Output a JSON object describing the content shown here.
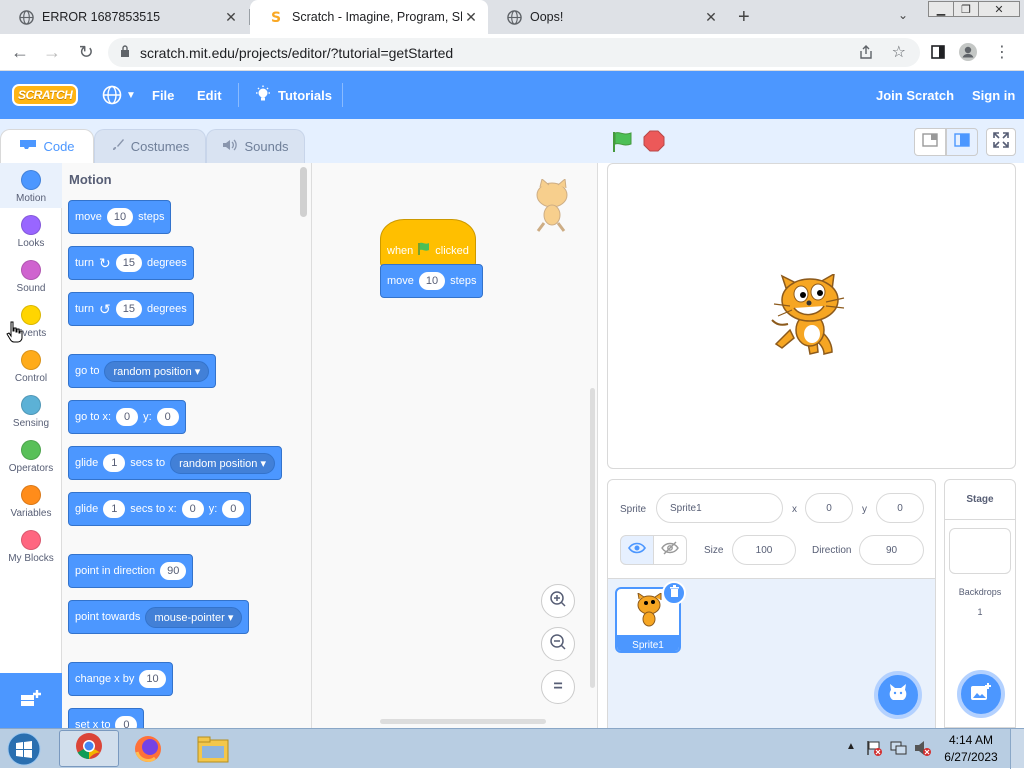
{
  "browser": {
    "tabs": [
      {
        "title": "ERROR 1687853515",
        "active": false
      },
      {
        "title": "Scratch - Imagine, Program, Shar",
        "active": true
      },
      {
        "title": "Oops!",
        "active": false
      }
    ],
    "new_tab": "+",
    "url": "scratch.mit.edu/projects/editor/?tutorial=getStarted"
  },
  "menubar": {
    "logo": "SCRATCH",
    "file": "File",
    "edit": "Edit",
    "tutorials": "Tutorials",
    "join": "Join Scratch",
    "signin": "Sign in"
  },
  "editor_tabs": {
    "code": "Code",
    "costumes": "Costumes",
    "sounds": "Sounds"
  },
  "categories": [
    {
      "label": "Motion",
      "color": "#4c97ff"
    },
    {
      "label": "Looks",
      "color": "#9966ff"
    },
    {
      "label": "Sound",
      "color": "#cf63cf"
    },
    {
      "label": "Events",
      "color": "#ffd500"
    },
    {
      "label": "Control",
      "color": "#ffab19"
    },
    {
      "label": "Sensing",
      "color": "#5cb1d6"
    },
    {
      "label": "Operators",
      "color": "#59c059"
    },
    {
      "label": "Variables",
      "color": "#ff8c1a"
    },
    {
      "label": "My Blocks",
      "color": "#ff6680"
    }
  ],
  "palette": {
    "heading": "Motion",
    "move": {
      "a": "move",
      "v": "10",
      "b": "steps"
    },
    "turn_cw": {
      "a": "turn",
      "v": "15",
      "b": "degrees"
    },
    "turn_ccw": {
      "a": "turn",
      "v": "15",
      "b": "degrees"
    },
    "goto": {
      "a": "go to",
      "dd": "random position"
    },
    "gotoxy": {
      "a": "go to x:",
      "x": "0",
      "b": "y:",
      "y": "0"
    },
    "glide1": {
      "a": "glide",
      "v": "1",
      "b": "secs to",
      "dd": "random position"
    },
    "glide2": {
      "a": "glide",
      "v": "1",
      "b": "secs to x:",
      "x": "0",
      "c": "y:",
      "y": "0"
    },
    "point_dir": {
      "a": "point in direction",
      "v": "90"
    },
    "point_towards": {
      "a": "point towards",
      "dd": "mouse-pointer"
    },
    "change_x": {
      "a": "change x by",
      "v": "10"
    },
    "set_x": {
      "a": "set x to",
      "v": "0"
    }
  },
  "script": {
    "hat": {
      "a": "when",
      "b": "clicked"
    },
    "move": {
      "a": "move",
      "v": "10",
      "b": "steps"
    },
    "zoom_in": "+",
    "zoom_out": "−",
    "zoom_reset": "="
  },
  "sprite_info": {
    "sprite_label": "Sprite",
    "sprite_name": "Sprite1",
    "x_label": "x",
    "x": "0",
    "y_label": "y",
    "y": "0",
    "show_label": "Show",
    "size_label": "Size",
    "size": "100",
    "direction_label": "Direction",
    "direction": "90",
    "thumb_name": "Sprite1"
  },
  "stage_pane": {
    "title": "Stage",
    "backdrops_label": "Backdrops",
    "backdrops": "1"
  },
  "taskbar": {
    "time": "4:14 AM",
    "date": "6/27/2023"
  }
}
